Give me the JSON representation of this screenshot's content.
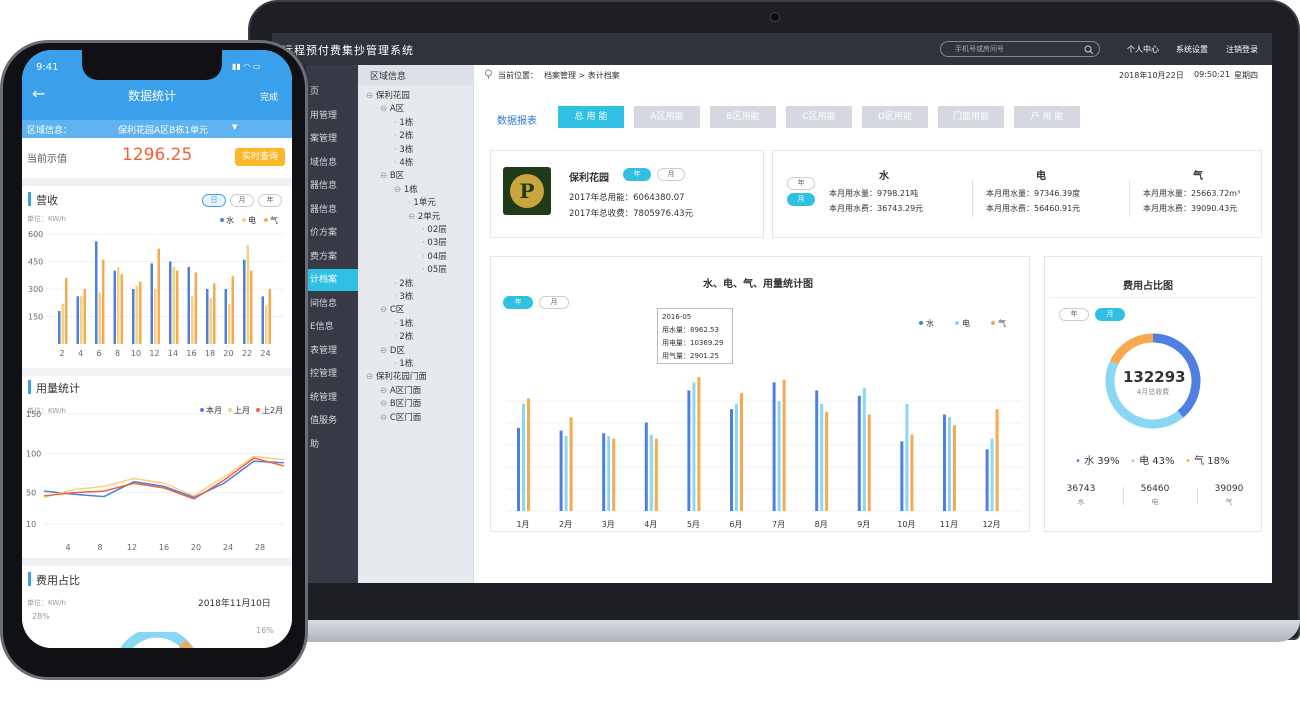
{
  "laptop": {
    "app_title": "远程预付费集抄管理系统",
    "search_placeholder": "手机号或房间号",
    "top_links": [
      "个人中心",
      "系统设置",
      "注销登录"
    ],
    "nav_items": [
      "页",
      "用管理",
      "案管理",
      "域信息",
      "器信息",
      "器信息",
      "价方案",
      "费方案",
      "计档案",
      "间信息",
      "E信息",
      "表管理",
      "控管理",
      "统管理",
      "值服务",
      "助"
    ],
    "nav_active_index": 8,
    "tree_header": "区域信息",
    "tree": [
      "保利花园",
      "A区",
      "1栋",
      "2栋",
      "3栋",
      "4栋",
      "B区",
      "1栋",
      "1单元",
      "2单元",
      "02层",
      "03层",
      "04层",
      "05层",
      "2栋",
      "3栋",
      "C区",
      "1栋",
      "2栋",
      "D区",
      "1栋",
      "保利花园门面",
      "A区门面",
      "B区门面",
      "C区门面"
    ],
    "breadcrumb_label": "当前位置：",
    "breadcrumb": "档案管理 > 表计档案",
    "datetime": "2018年10月22日",
    "time": "09:50:21",
    "weekday": "星期四",
    "report_label": "数据报表",
    "tabs": [
      "总 用 能",
      "A区用能",
      "B区用能",
      "C区用能",
      "D区用能",
      "门面用能",
      "户 用 能"
    ],
    "site": {
      "name": "保利花园",
      "toggle": [
        "年",
        "月"
      ],
      "total_energy": "2017年总用能：6064380.07",
      "total_fee": "2017年总收费：7805976.43元"
    },
    "utility_toggle": [
      "年",
      "月"
    ],
    "utilities": [
      {
        "name": "水",
        "usage": "本月用水量：9798.21吨",
        "fee": "本月用水费：36743.29元"
      },
      {
        "name": "电",
        "usage": "本月用水量：97346.39度",
        "fee": "本月用水费：56460.91元"
      },
      {
        "name": "气",
        "usage": "本月用水量：25663.72m³",
        "fee": "本月用水费：39090.43元"
      }
    ],
    "chart_title": "水、电、气、用量统计图",
    "chart_toggle": [
      "年",
      "月"
    ],
    "tooltip": [
      "2016-05",
      "用水量：8962.53",
      "用电量：10369.29",
      "用气量：2901.25"
    ],
    "colors": {
      "water": "#4f7fe3",
      "elec": "#8ad6f5",
      "gas": "#f6a94f",
      "accent": "#2fc0e3"
    },
    "fee_title": "费用占比图",
    "fee_toggle": [
      "年",
      "月"
    ],
    "fee_total": "132293",
    "fee_sub": "4月总收费",
    "fee_legend": [
      "水 39%",
      "电 43%",
      "气 18%"
    ],
    "fee_values": [
      {
        "v": "36743",
        "k": "水"
      },
      {
        "v": "56460",
        "k": "电"
      },
      {
        "v": "39090",
        "k": "气"
      }
    ]
  },
  "chart_data": [
    {
      "type": "bar",
      "title": "水、电、气、用量统计图",
      "categories": [
        "1月",
        "2月",
        "3月",
        "4月",
        "5月",
        "6月",
        "7月",
        "8月",
        "9月",
        "10月",
        "11月",
        "12月"
      ],
      "series": [
        {
          "name": "水",
          "values": [
            62,
            60,
            58,
            66,
            90,
            76,
            96,
            90,
            86,
            52,
            72,
            46
          ]
        },
        {
          "name": "电",
          "values": [
            80,
            56,
            56,
            57,
            96,
            80,
            82,
            80,
            92,
            80,
            70,
            54
          ]
        },
        {
          "name": "气",
          "values": [
            84,
            70,
            54,
            54,
            100,
            88,
            98,
            74,
            72,
            57,
            64,
            76
          ]
        }
      ]
    },
    {
      "type": "pie",
      "title": "费用占比图",
      "labels": [
        "水",
        "电",
        "气"
      ],
      "values": [
        39,
        43,
        18
      ]
    },
    {
      "type": "bar",
      "title": "营收",
      "categories": [
        "2",
        "4",
        "6",
        "8",
        "10",
        "12",
        "14",
        "16",
        "18",
        "20",
        "22",
        "24"
      ],
      "series": [
        {
          "name": "水",
          "values": [
            180,
            260,
            560,
            400,
            300,
            440,
            450,
            420,
            300,
            300,
            460,
            260
          ]
        },
        {
          "name": "电",
          "values": [
            220,
            260,
            280,
            420,
            320,
            300,
            420,
            260,
            250,
            220,
            540,
            210
          ]
        },
        {
          "name": "气",
          "values": [
            360,
            300,
            460,
            380,
            340,
            520,
            400,
            390,
            330,
            370,
            400,
            300
          ]
        }
      ],
      "ylim": [
        0,
        600
      ]
    },
    {
      "type": "line",
      "title": "用量统计",
      "x": [
        0,
        4,
        8,
        12,
        16,
        20,
        24,
        28,
        32
      ],
      "series": [
        {
          "name": "本月",
          "values": [
            52,
            48,
            45,
            64,
            58,
            44,
            62,
            90,
            88
          ]
        },
        {
          "name": "上月",
          "values": [
            44,
            54,
            58,
            68,
            62,
            46,
            70,
            96,
            92
          ]
        },
        {
          "name": "上2月",
          "values": [
            46,
            50,
            52,
            62,
            56,
            42,
            66,
            94,
            84
          ]
        }
      ],
      "ylim": [
        0,
        150
      ]
    }
  ],
  "phone": {
    "time": "9:41",
    "title": "数据统计",
    "done": "完成",
    "back_icon": "back-arrow-icon",
    "region_label": "区域信息：",
    "region_value": "保利花园A区B栋1单元",
    "current_label": "当前示值",
    "current_value": "1296.25",
    "realtime_btn": "实时查询",
    "revenue_title": "营收",
    "revenue_toggle": [
      "日",
      "月",
      "年"
    ],
    "unit": "单位：KW/h",
    "revenue_legend": [
      "水",
      "电",
      "气"
    ],
    "revenue_yticks": [
      "600",
      "450",
      "300",
      "150"
    ],
    "revenue_xticks": [
      "2",
      "4",
      "6",
      "8",
      "10",
      "12",
      "14",
      "16",
      "18",
      "20",
      "22",
      "24"
    ],
    "usage_title": "用量统计",
    "usage_legend": [
      "本月",
      "上月",
      "上2月"
    ],
    "usage_yticks": [
      "150",
      "100",
      "50",
      "10"
    ],
    "usage_xticks": [
      "4",
      "8",
      "12",
      "16",
      "20",
      "24",
      "28"
    ],
    "fee_title": "费用占比",
    "fee_date": "2018年11月10日",
    "fee_pct_left": "28%",
    "fee_pct_right": "16%"
  }
}
